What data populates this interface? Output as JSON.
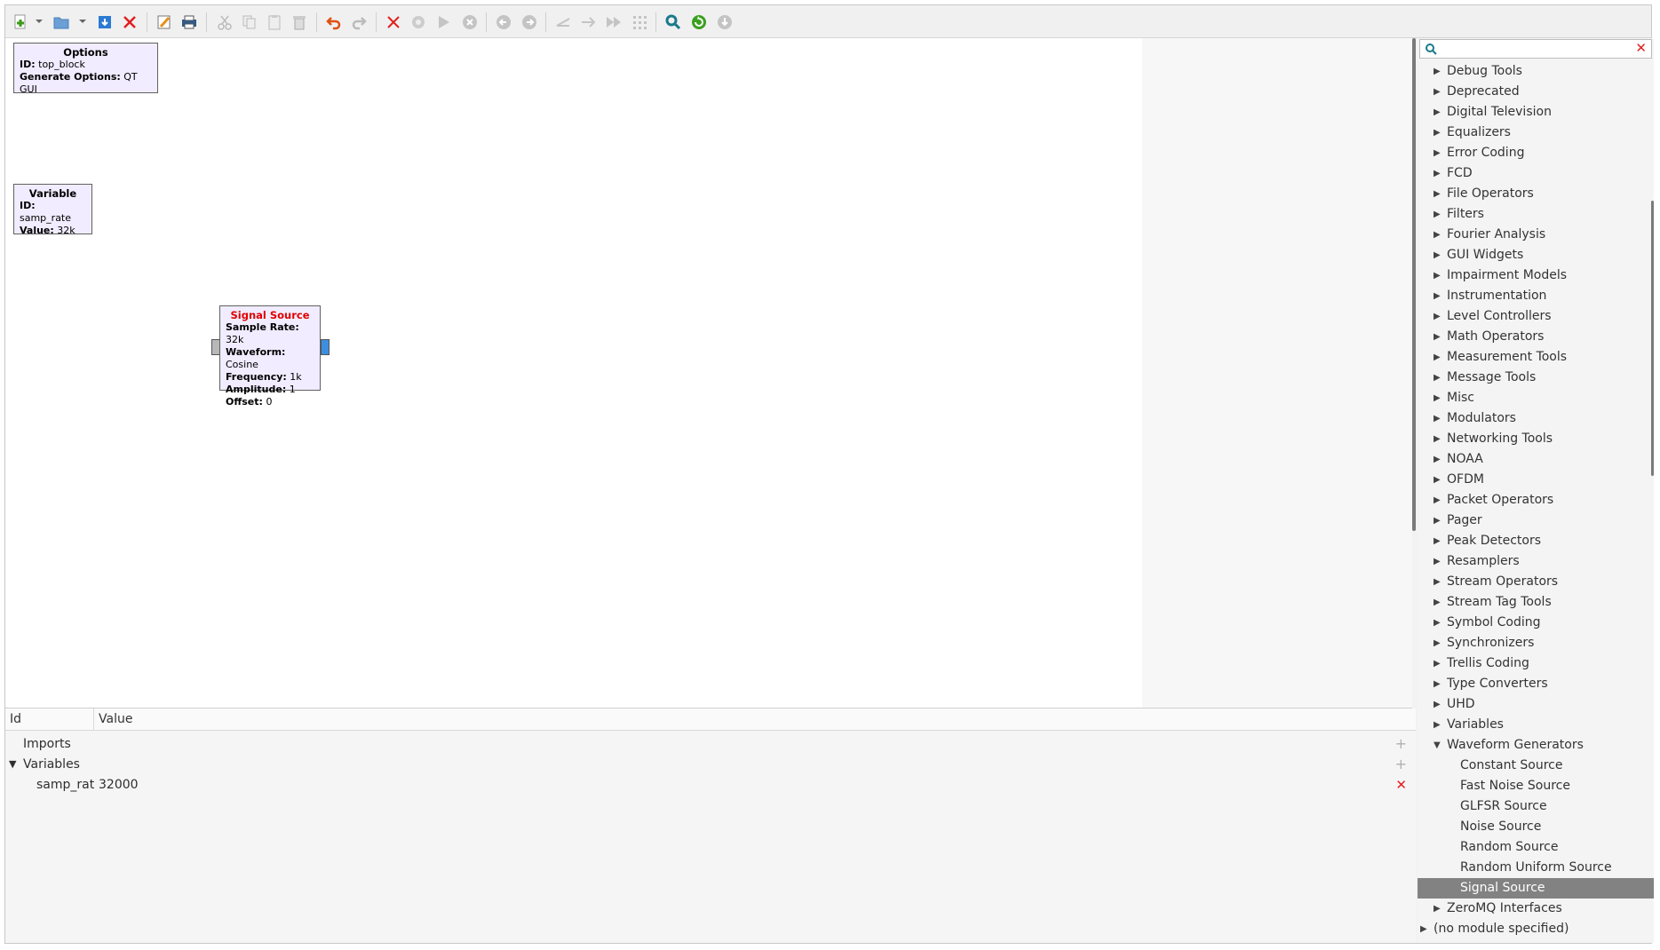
{
  "colors": {
    "block_fill": "#f1ecff",
    "selected_row": "#828282",
    "error_red": "#e00000",
    "output_port": "#3c8fe0"
  },
  "toolbar": {
    "icons": [
      "new-icon",
      "open-icon",
      "save-icon",
      "close-icon",
      "properties-icon",
      "print-icon",
      "cut-icon",
      "copy-icon",
      "paste-icon",
      "delete-icon",
      "undo-icon",
      "redo-icon",
      "remove-icon",
      "disable-icon",
      "run-icon",
      "stop-icon",
      "rotate-ccw-icon",
      "rotate-cw-icon",
      "enable-icon",
      "bypass-icon",
      "execute-icon",
      "grid-icon",
      "find-icon",
      "reload-icon",
      "kill-icon"
    ]
  },
  "blocks": {
    "options": {
      "title": "Options",
      "rows": [
        {
          "key": "ID:",
          "val": "top_block"
        },
        {
          "key": "Generate Options:",
          "val": "QT GUI"
        }
      ]
    },
    "variable": {
      "title": "Variable",
      "rows": [
        {
          "key": "ID:",
          "val": "samp_rate"
        },
        {
          "key": "Value:",
          "val": "32k"
        }
      ]
    },
    "signal_source": {
      "title": "Signal Source",
      "rows": [
        {
          "key": "Sample Rate:",
          "val": "32k"
        },
        {
          "key": "Waveform:",
          "val": "Cosine"
        },
        {
          "key": "Frequency:",
          "val": "1k"
        },
        {
          "key": "Amplitude:",
          "val": "1"
        },
        {
          "key": "Offset:",
          "val": "0"
        }
      ]
    }
  },
  "variables_pane": {
    "col_id": "Id",
    "col_value": "Value",
    "imports": "Imports",
    "variables": "Variables",
    "var_id": "samp_rat",
    "var_value": "32000"
  },
  "library": {
    "search_placeholder": "",
    "categories": [
      "Debug Tools",
      "Deprecated",
      "Digital Television",
      "Equalizers",
      "Error Coding",
      "FCD",
      "File Operators",
      "Filters",
      "Fourier Analysis",
      "GUI Widgets",
      "Impairment Models",
      "Instrumentation",
      "Level Controllers",
      "Math Operators",
      "Measurement Tools",
      "Message Tools",
      "Misc",
      "Modulators",
      "Networking Tools",
      "NOAA",
      "OFDM",
      "Packet Operators",
      "Pager",
      "Peak Detectors",
      "Resamplers",
      "Stream Operators",
      "Stream Tag Tools",
      "Symbol Coding",
      "Synchronizers",
      "Trellis Coding",
      "Type Converters",
      "UHD",
      "Variables"
    ],
    "expanded": "Waveform Generators",
    "children": [
      "Constant Source",
      "Fast Noise Source",
      "GLFSR Source",
      "Noise Source",
      "Random Source",
      "Random Uniform Source",
      "Signal Source"
    ],
    "selected": "Signal Source",
    "after": [
      "ZeroMQ Interfaces"
    ],
    "root_extra": "(no module specified)"
  }
}
